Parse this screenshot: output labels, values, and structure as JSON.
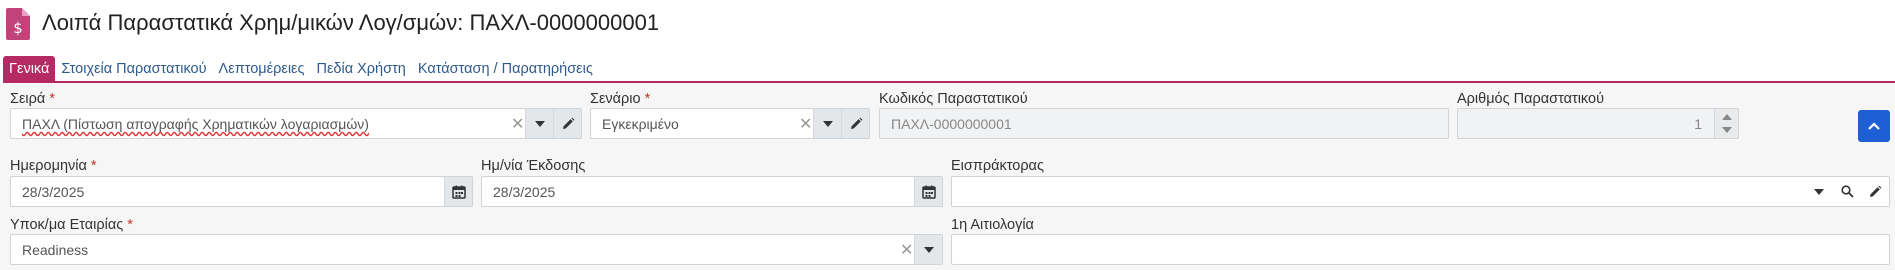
{
  "page": {
    "title": "Λοιπά Παραστατικά Χρημ/μικών Λογ/σμών: ΠΑΧΛ-0000000001",
    "icon": "document-dollar-icon"
  },
  "tabs": [
    {
      "label": "Γενικά",
      "active": true
    },
    {
      "label": "Στοιχεία Παραστατικού",
      "active": false
    },
    {
      "label": "Λεπτομέρειες",
      "active": false
    },
    {
      "label": "Πεδία Χρήστη",
      "active": false
    },
    {
      "label": "Κατάσταση / Παρατηρήσεις",
      "active": false
    }
  ],
  "fields": {
    "series": {
      "label": "Σειρά",
      "required_mark": "*",
      "value": "ΠΑΧΛ (Πίστωση απογραφής Χρηματικών λογαριασμών)"
    },
    "scenario": {
      "label": "Σενάριο",
      "required_mark": "*",
      "value": "Εγκεκριμένο"
    },
    "doc_code": {
      "label": "Κωδικός Παραστατικού",
      "value": "ΠΑΧΛ-0000000001"
    },
    "doc_number": {
      "label": "Αριθμός Παραστατικού",
      "value": "1"
    },
    "date": {
      "label": "Ημερομηνία",
      "required_mark": "*",
      "value": "28/3/2025"
    },
    "issue_date": {
      "label": "Ημ/νία Έκδοσης",
      "value": "28/3/2025"
    },
    "collector": {
      "label": "Εισπράκτορας",
      "value": ""
    },
    "branch": {
      "label": "Υποκ/μα Εταιρίας",
      "required_mark": "*",
      "value": "Readiness"
    },
    "reason1": {
      "label": "1η Αιτιολογία",
      "value": ""
    }
  },
  "colors": {
    "accent": "#b52a63",
    "link": "#2f5a8c",
    "primary_button": "#1e5fd6",
    "required": "#c0392b"
  }
}
